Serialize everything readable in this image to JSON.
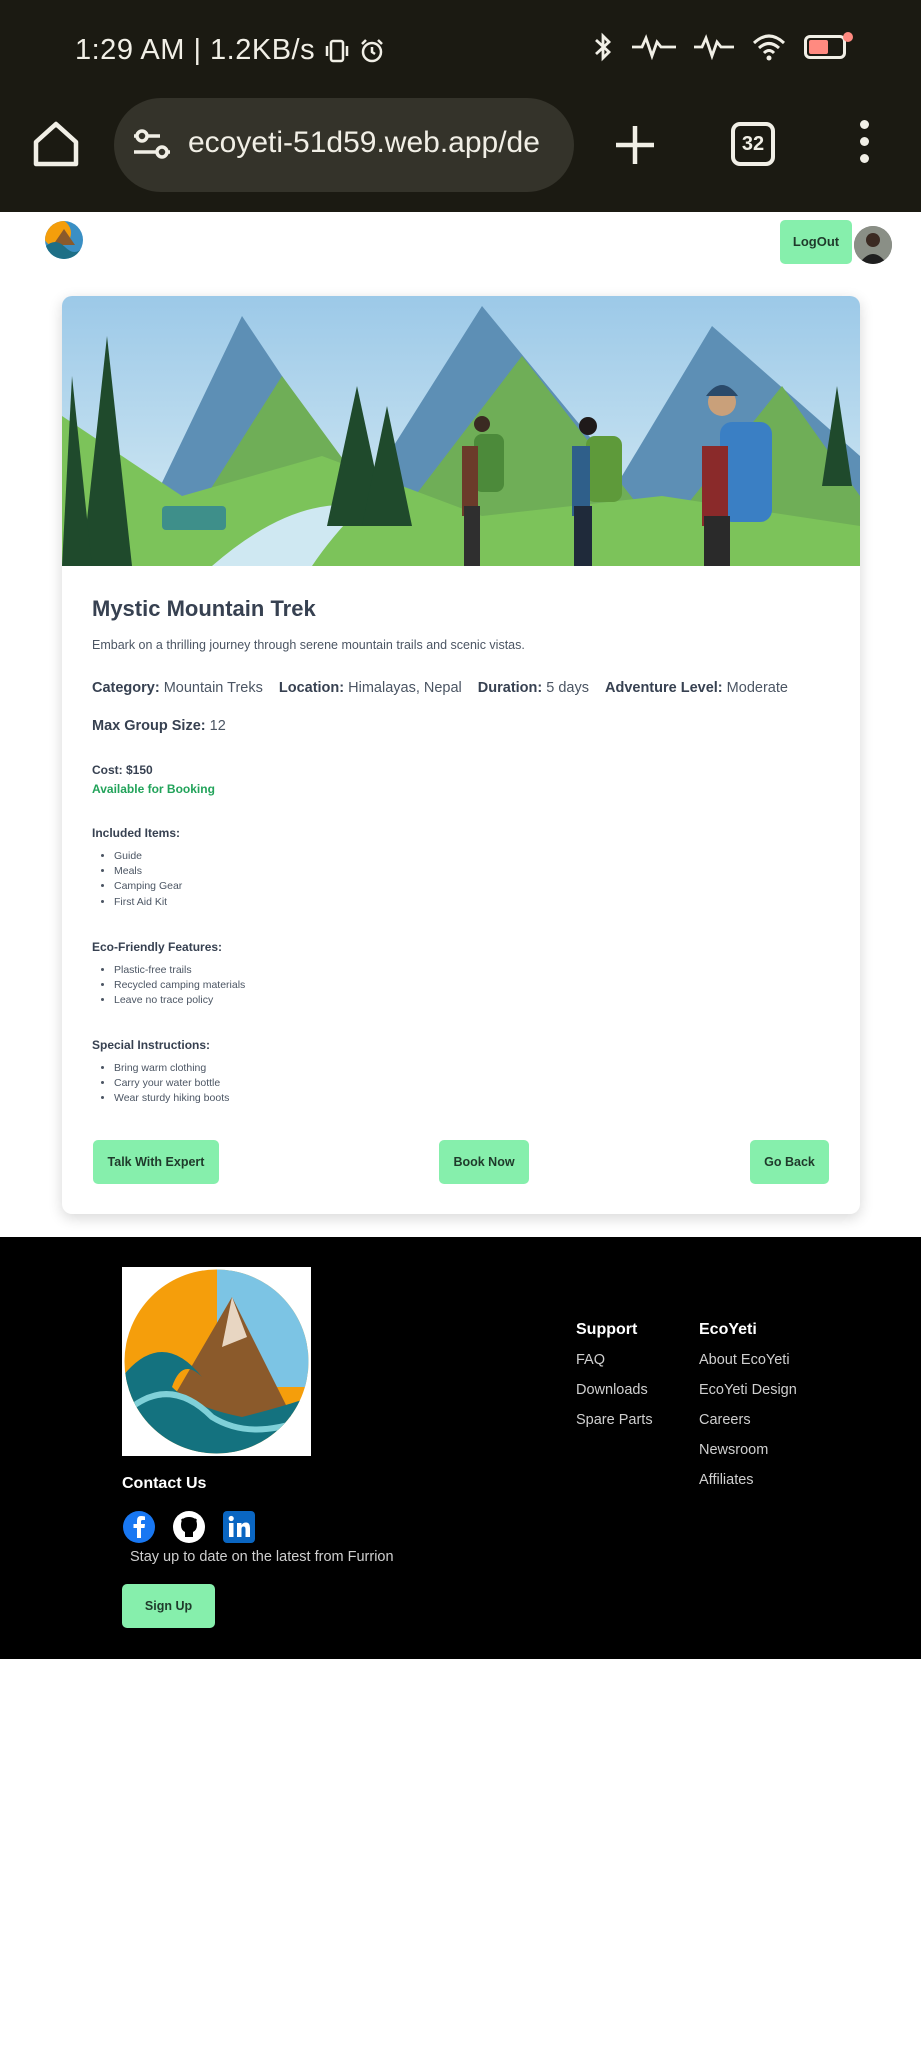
{
  "status_bar": {
    "time_text": "1:29 AM | 1.2KB/s",
    "battery_percent": 60
  },
  "browser": {
    "url": "ecoyeti-51d59.web.app/de",
    "tab_count": "32"
  },
  "header": {
    "logout_label": "LogOut"
  },
  "trek": {
    "title": "Mystic Mountain Trek",
    "description": "Embark on a thrilling journey through serene mountain trails and scenic vistas.",
    "meta": [
      {
        "label": "Category:",
        "value": "Mountain Treks"
      },
      {
        "label": "Location:",
        "value": "Himalayas, Nepal"
      },
      {
        "label": "Duration:",
        "value": "5 days"
      },
      {
        "label": "Adventure Level:",
        "value": "Moderate"
      }
    ],
    "group_label": "Max Group Size:",
    "group_value": "12",
    "cost": "Cost: $150",
    "availability": "Available for Booking",
    "sections": [
      {
        "title": "Included Items:",
        "items": [
          "Guide",
          "Meals",
          "Camping Gear",
          "First Aid Kit"
        ]
      },
      {
        "title": "Eco-Friendly Features:",
        "items": [
          "Plastic-free trails",
          "Recycled camping materials",
          "Leave no trace policy"
        ]
      },
      {
        "title": "Special Instructions:",
        "items": [
          "Bring warm clothing",
          "Carry your water bottle",
          "Wear sturdy hiking boots"
        ]
      }
    ],
    "buttons": {
      "talk": "Talk With Expert",
      "book": "Book Now",
      "back": "Go Back"
    }
  },
  "footer": {
    "contact_title": "Contact Us",
    "tagline": "Stay up to date on the latest from Furrion",
    "signup_label": "Sign Up",
    "support": {
      "title": "Support",
      "links": [
        "FAQ",
        "Downloads",
        "Spare Parts"
      ]
    },
    "ecoyeti": {
      "title": "EcoYeti",
      "links": [
        "About EcoYeti",
        "EcoYeti Design",
        "Careers",
        "Newsroom",
        "Affiliates"
      ]
    }
  },
  "colors": {
    "accent_button": "#86efac",
    "available_green": "#22a35a",
    "chrome_bg": "#1b1a12"
  }
}
